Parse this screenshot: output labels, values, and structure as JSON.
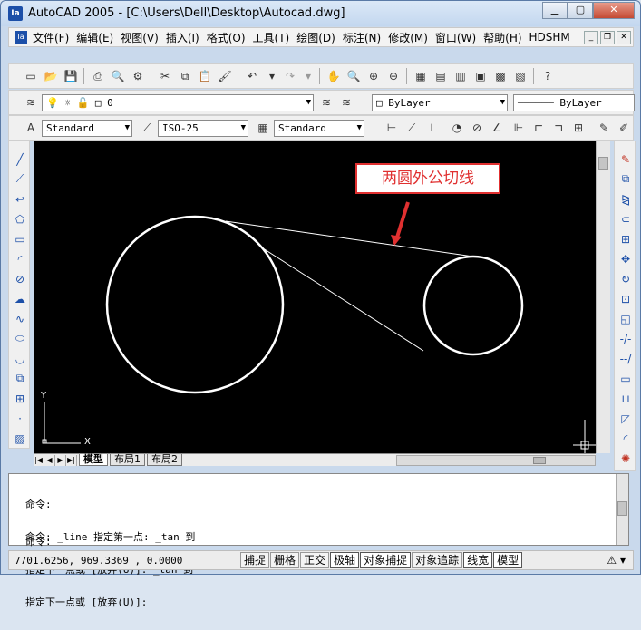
{
  "window": {
    "title": "AutoCAD 2005 - [C:\\Users\\Dell\\Desktop\\Autocad.dwg]",
    "app_icon": "Ia"
  },
  "menubar": {
    "items": [
      "文件(F)",
      "编辑(E)",
      "视图(V)",
      "插入(I)",
      "格式(O)",
      "工具(T)",
      "绘图(D)",
      "标注(N)",
      "修改(M)",
      "窗口(W)",
      "帮助(H)",
      "HDSHM"
    ]
  },
  "layers": {
    "current_layer": "0",
    "color": "ByLayer",
    "linetype": "ByLayer"
  },
  "styles": {
    "text_style": "Standard",
    "dim_style": "ISO-25",
    "table_style": "Standard"
  },
  "canvas": {
    "annotation": "两圆外公切线",
    "annotation_color": "#e03030",
    "ucs_y": "Y",
    "ucs_x": "X"
  },
  "tabs": {
    "model": "模型",
    "layout1": "布局1",
    "layout2": "布局2"
  },
  "command": {
    "history": [
      "命令:",
      "命令: _line 指定第一点: _tan 到",
      "指定下一点或 [放弃(U)]: _tan 到",
      "指定下一点或 [放弃(U)]:"
    ],
    "prompt": "命令:"
  },
  "status": {
    "coords": "7701.6256, 969.3369 , 0.0000",
    "buttons": [
      "捕捉",
      "栅格",
      "正交",
      "极轴",
      "对象捕捉",
      "对象追踪",
      "线宽",
      "模型"
    ],
    "on_buttons": [
      "极轴",
      "对象捕捉",
      "线宽",
      "模型"
    ]
  }
}
